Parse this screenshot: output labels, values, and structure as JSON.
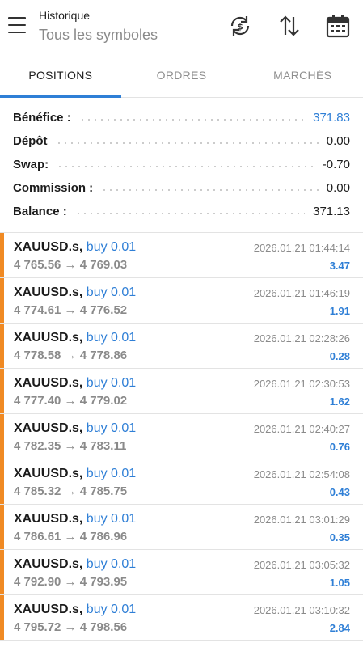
{
  "header": {
    "title": "Historique",
    "subtitle": "Tous les symboles",
    "icons": [
      "menu-icon",
      "currency-swap-icon",
      "sort-icon",
      "calendar-icon"
    ]
  },
  "tabs": [
    {
      "label": "POSITIONS",
      "active": true
    },
    {
      "label": "ORDRES",
      "active": false
    },
    {
      "label": "MARCHÉS",
      "active": false
    }
  ],
  "summary": [
    {
      "label": "Bénéfice :",
      "value": "371.83",
      "highlight": true
    },
    {
      "label": "Dépôt",
      "value": "0.00",
      "highlight": false
    },
    {
      "label": "Swap:",
      "value": "-0.70",
      "highlight": false
    },
    {
      "label": "Commission :",
      "value": "0.00",
      "highlight": false
    },
    {
      "label": "Balance :",
      "value": "371.13",
      "highlight": false
    }
  ],
  "trades": [
    {
      "symbol": "XAUUSD.s",
      "side": "buy 0.01",
      "open": "4 765.56",
      "close": "4 769.03",
      "time": "2026.01.21 01:44:14",
      "profit": "3.47"
    },
    {
      "symbol": "XAUUSD.s",
      "side": "buy 0.01",
      "open": "4 774.61",
      "close": "4 776.52",
      "time": "2026.01.21 01:46:19",
      "profit": "1.91"
    },
    {
      "symbol": "XAUUSD.s",
      "side": "buy 0.01",
      "open": "4 778.58",
      "close": "4 778.86",
      "time": "2026.01.21 02:28:26",
      "profit": "0.28"
    },
    {
      "symbol": "XAUUSD.s",
      "side": "buy 0.01",
      "open": "4 777.40",
      "close": "4 779.02",
      "time": "2026.01.21 02:30:53",
      "profit": "1.62"
    },
    {
      "symbol": "XAUUSD.s",
      "side": "buy 0.01",
      "open": "4 782.35",
      "close": "4 783.11",
      "time": "2026.01.21 02:40:27",
      "profit": "0.76"
    },
    {
      "symbol": "XAUUSD.s",
      "side": "buy 0.01",
      "open": "4 785.32",
      "close": "4 785.75",
      "time": "2026.01.21 02:54:08",
      "profit": "0.43"
    },
    {
      "symbol": "XAUUSD.s",
      "side": "buy 0.01",
      "open": "4 786.61",
      "close": "4 786.96",
      "time": "2026.01.21 03:01:29",
      "profit": "0.35"
    },
    {
      "symbol": "XAUUSD.s",
      "side": "buy 0.01",
      "open": "4 792.90",
      "close": "4 793.95",
      "time": "2026.01.21 03:05:32",
      "profit": "1.05"
    },
    {
      "symbol": "XAUUSD.s",
      "side": "buy 0.01",
      "open": "4 795.72",
      "close": "4 798.56",
      "time": "2026.01.21 03:10:32",
      "profit": "2.84"
    }
  ],
  "colors": {
    "accent": "#2f7fd6",
    "buy_marker": "#f08a24",
    "muted": "#8a8a8a"
  }
}
